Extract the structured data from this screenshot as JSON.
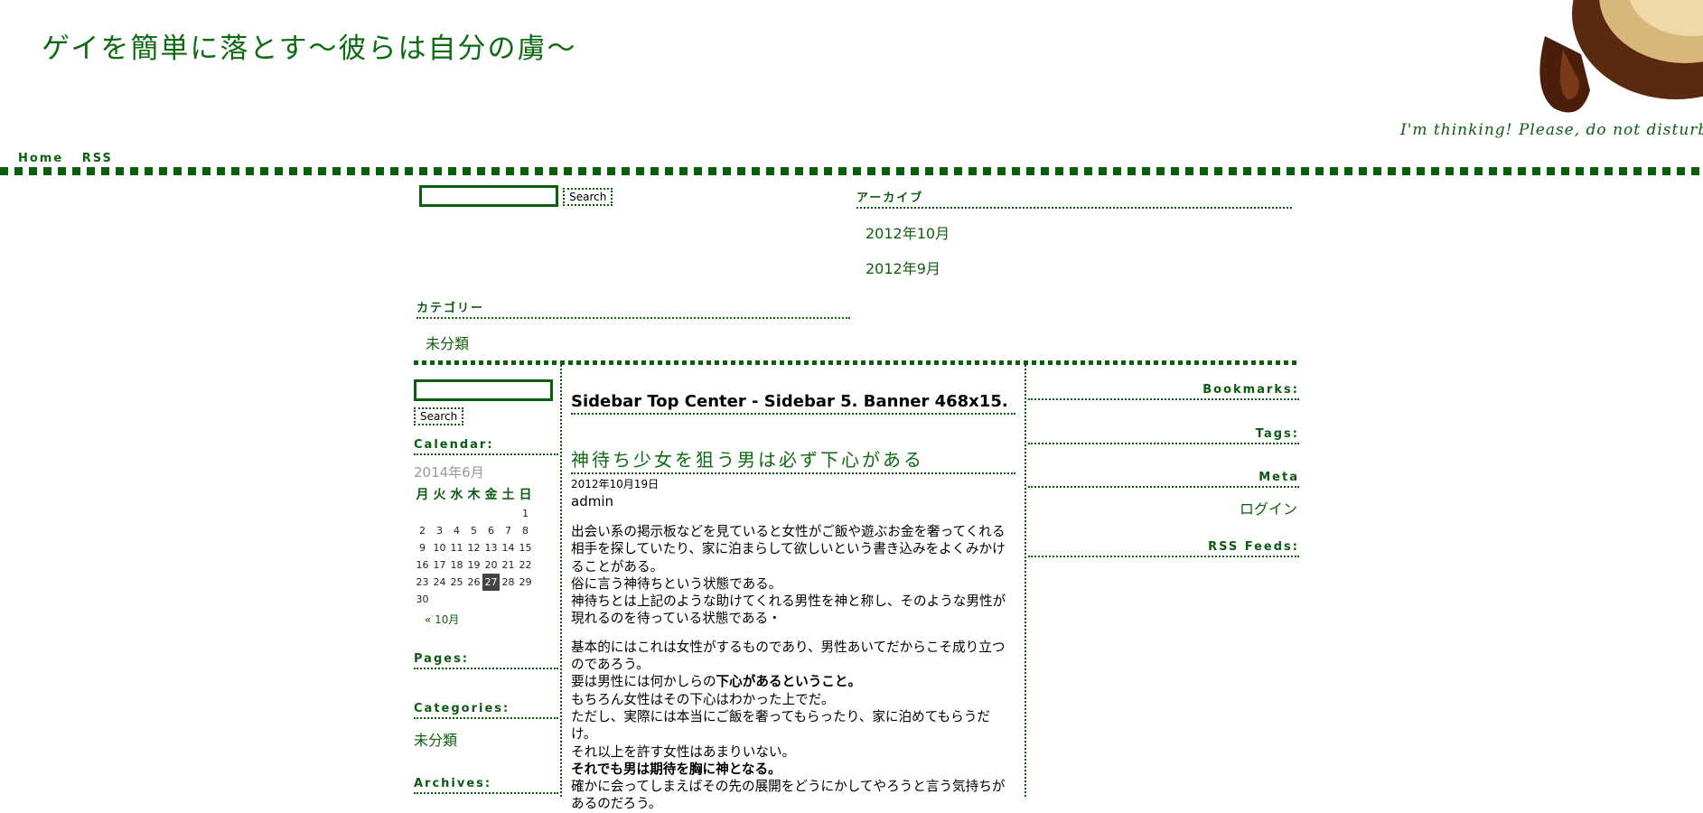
{
  "header": {
    "site_title": "ゲイを簡単に落とす～彼らは自分の虜～",
    "tagline": "I'm thinking! Please, do not disturb",
    "nav": [
      "Home",
      "RSS"
    ]
  },
  "top_search": {
    "button_label": "Search",
    "value": ""
  },
  "top_widgets": {
    "archives": {
      "title": "アーカイブ",
      "items": [
        "2012年10月",
        "2012年9月"
      ]
    },
    "categories": {
      "title": "カテゴリー",
      "items": [
        "未分類"
      ]
    }
  },
  "left_sidebar": {
    "search_button_label": "Search",
    "calendar": {
      "title": "Calendar:",
      "caption": "2014年6月",
      "weekdays": [
        "月",
        "火",
        "水",
        "木",
        "金",
        "土",
        "日"
      ],
      "weeks": [
        [
          "",
          "",
          "",
          "",
          "",
          "",
          "1"
        ],
        [
          "2",
          "3",
          "4",
          "5",
          "6",
          "7",
          "8"
        ],
        [
          "9",
          "10",
          "11",
          "12",
          "13",
          "14",
          "15"
        ],
        [
          "16",
          "17",
          "18",
          "19",
          "20",
          "21",
          "22"
        ],
        [
          "23",
          "24",
          "25",
          "26",
          "27",
          "28",
          "29"
        ],
        [
          "30",
          "",
          "",
          "",
          "",
          "",
          ""
        ]
      ],
      "today": "27",
      "prev_link": "« 10月"
    },
    "pages_title": "Pages:",
    "categories_title": "Categories:",
    "category_item": "未分類",
    "archives_title": "Archives:"
  },
  "main": {
    "banner": "Sidebar Top Center - Sidebar 5. Banner 468x15.",
    "post": {
      "title": "神待ち少女を狙う男は必ず下心がある",
      "date": "2012年10月19日",
      "author": "admin",
      "p1": [
        "出会い系の掲示板などを見ていると女性がご飯や遊ぶお金を奢ってくれる相手を探していたり、家に泊まらして欲しいという書き込みをよくみかけることがある。",
        "俗に言う神待ちという状態である。",
        "神待ちとは上記のような助けてくれる男性を神と称し、そのような男性が現れるのを待っている状態である・"
      ],
      "p2_line1": "基本的にはこれは女性がするものであり、男性あいてだからこそ成り立つのであろう。",
      "p2_line2_plain": "要は男性には何かしらの",
      "p2_line2_bold": "下心があるということ。",
      "p2_line3": "もちろん女性はその下心はわかった上でだ。",
      "p2_line4": "ただし、実際には本当にご飯を奢ってもらったり、家に泊めてもらうだけ。",
      "p2_line5": "それ以上を許す女性はあまりいない。",
      "p2_line6_bold": "それでも男は期待を胸に神となる。",
      "p2_line7": "確かに会ってしまえばその先の展開をどうにかしてやろうと言う気持ちがあるのだろう。"
    }
  },
  "right_sidebar": {
    "bookmarks_title": "Bookmarks:",
    "tags_title": "Tags:",
    "meta_title": "Meta",
    "login_link": "ログイン",
    "rss_title": "RSS Feeds:"
  },
  "colors": {
    "accent": "#0b5e0b",
    "title_green": "#0d6b12"
  }
}
